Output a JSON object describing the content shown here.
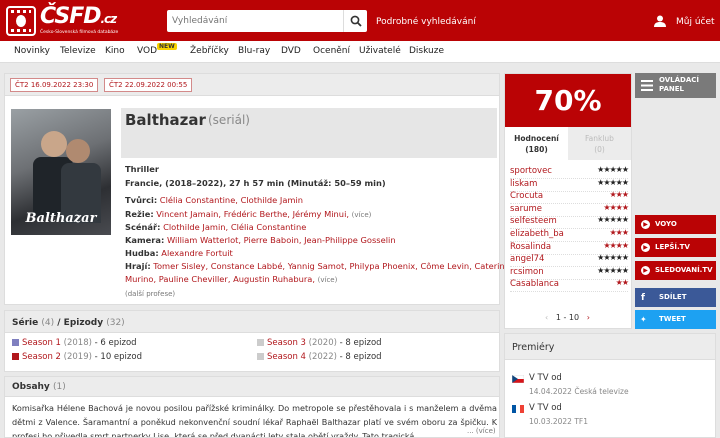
{
  "header": {
    "logo_text": "ČSFD",
    "logo_suffix": ".cz",
    "logo_tagline": "Česko-Slovenská filmová databáze",
    "search_placeholder": "Vyhledávání",
    "advanced_search": "Podrobné vyhledávání",
    "account": "Můj účet"
  },
  "nav": {
    "items": [
      "Novinky",
      "Televize",
      "Kino",
      "VOD",
      "Žebříčky",
      "Blu-ray",
      "DVD",
      "Ocenění",
      "Uživatelé",
      "Diskuze"
    ],
    "badge": "NEW"
  },
  "film": {
    "dates": [
      "ČT2 16.09.2022 23:30",
      "ČT2 22.09.2022 00:55"
    ],
    "poster_text": "Balthazar",
    "title": "Balthazar",
    "kind": "(seriál)",
    "genre": "Thriller",
    "origin": "Francie, (2018–2022), 27 h 57 min (Minutáž: 50–59 min)",
    "creators_label": "Tvůrci:",
    "creators": "Clélia Constantine, Clothilde Jamin",
    "director_label": "Režie:",
    "director": "Vincent Jamain, Frédéric Berthe, Jérémy Minui,",
    "more": "(více)",
    "screenplay_label": "Scénář:",
    "screenplay": "Clothilde Jamin, Clélia Constantine",
    "camera_label": "Kamera:",
    "camera": "William Watterlot, Pierre Baboin, Jean-Philippe Gosselin",
    "music_label": "Hudba:",
    "music": "Alexandre Fortuit",
    "cast_label": "Hrají:",
    "cast1": "Tomer Sisley, Constance Labbé, Yannig Samot, Philypa Phoenix, Côme Levin, Caterina",
    "cast2": "Murino, Pauline Cheviller, Augustin Ruhabura,",
    "other_profs": "(další profese)"
  },
  "series": {
    "title": "Série",
    "count": "(4)",
    "sep": "/ Epizody",
    "ep_count": "(32)",
    "seasons": [
      {
        "name": "Season 1",
        "year": "(2018)",
        "eps": "- 6 epizod",
        "color": "#7f7fbf"
      },
      {
        "name": "Season 2",
        "year": "(2019)",
        "eps": "- 10 epizod",
        "color": "#b1171c"
      },
      {
        "name": "Season 3",
        "year": "(2020)",
        "eps": "- 8 epizod",
        "color": "#cccccc"
      },
      {
        "name": "Season 4",
        "year": "(2022)",
        "eps": "- 8 epizod",
        "color": "#cccccc"
      }
    ]
  },
  "synopsis": {
    "title": "Obsahy",
    "count": "(1)",
    "text": "Komisařka Hélene Bachová je novou posilou pařížské kriminálky. Do metropole se přestěhovala i s manželem a dvěma dětmi z Valence. Šaramantní a poněkud nekonvenční soudní lékař Raphaël Balthazar platí ve svém oboru za špičku. K profesi ho přivedla smrt partnerky Lise, která se před dvanácti lety stala obětí vraždy. Tato tragická",
    "more": "... (více)"
  },
  "rating": {
    "percent": "70%",
    "tab_active": "Hodnocení",
    "tab_active_count": "(180)",
    "tab_inactive": "Fanklub",
    "tab_inactive_count": "(0)",
    "rows": [
      {
        "user": "sportovec",
        "stars": "★★★★★",
        "tone": "b"
      },
      {
        "user": "liskam",
        "stars": "★★★★★",
        "tone": "b"
      },
      {
        "user": "Crocuta",
        "stars": "★★★",
        "tone": "r"
      },
      {
        "user": "sarume",
        "stars": "★★★★",
        "tone": "r"
      },
      {
        "user": "selfesteem",
        "stars": "★★★★★",
        "tone": "b"
      },
      {
        "user": "elizabeth_ba",
        "stars": "★★★",
        "tone": "r"
      },
      {
        "user": "Rosalinda",
        "stars": "★★★★",
        "tone": "r"
      },
      {
        "user": "angel74",
        "stars": "★★★★★",
        "tone": "b"
      },
      {
        "user": "rcsimon",
        "stars": "★★★★★",
        "tone": "b"
      },
      {
        "user": "Casablanca",
        "stars": "★★",
        "tone": "r"
      }
    ],
    "pager": "1 - 10"
  },
  "side": {
    "control_panel": "OVLÁDACÍ PANEL",
    "voyo": "VOYO",
    "lepsi": "LEPŠÍ.TV",
    "sledovani": "SLEDOVANÍ.TV",
    "share": "SDÍLET",
    "tweet": "TWEET"
  },
  "premieres": {
    "title": "Premiéry",
    "items": [
      {
        "label": "V TV od",
        "date": "14.04.2022 Česká televize"
      },
      {
        "label": "V TV od",
        "date": "10.03.2022 TF1"
      }
    ]
  }
}
